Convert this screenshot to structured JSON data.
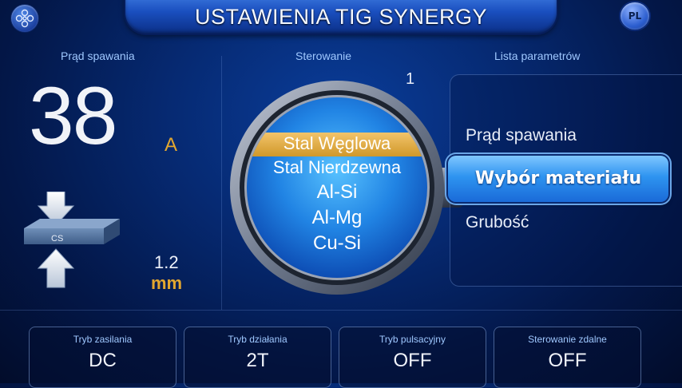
{
  "header": {
    "title": "USTAWIENIA TIG SYNERGY",
    "lang": "PL"
  },
  "sections": {
    "current": "Prąd spawania",
    "control": "Sterowanie",
    "params": "Lista parametrów"
  },
  "current": {
    "value": "38",
    "unit": "A"
  },
  "thickness": {
    "material_tag": "CS",
    "value": "1.2",
    "unit": "mm"
  },
  "control": {
    "index": "1",
    "materials": [
      "Stal Węglowa",
      "Stal Nierdzewna",
      "Al-Si",
      "Al-Mg",
      "Cu-Si"
    ],
    "selected_material": "Stal Węglowa"
  },
  "params": {
    "items": [
      "Prąd spawania",
      "Wybór materiału",
      "Grubość"
    ],
    "selected": "Wybór materiału"
  },
  "bottom": [
    {
      "label": "Tryb zasilania",
      "value": "DC"
    },
    {
      "label": "Tryb działania",
      "value": "2T"
    },
    {
      "label": "Tryb pulsacyjny",
      "value": "OFF"
    },
    {
      "label": "Sterowanie zdalne",
      "value": "OFF"
    }
  ],
  "colors": {
    "accent": "#e3a72f",
    "selection": "#2e94f0",
    "header": "#1a4fbf"
  }
}
